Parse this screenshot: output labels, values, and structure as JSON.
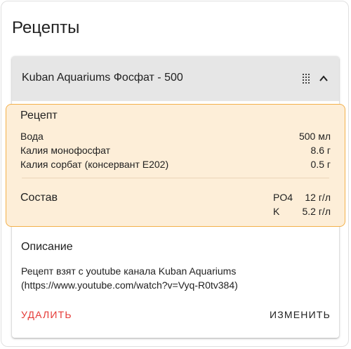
{
  "page": {
    "title": "Рецепты"
  },
  "card": {
    "title": "Kuban Aquariums Фосфат - 500",
    "icons": {
      "drag": "drag-handle-icon",
      "collapse": "chevron-up-icon"
    }
  },
  "recipe": {
    "title": "Рецепт",
    "items": [
      {
        "name": "Вода",
        "amount": "500 мл"
      },
      {
        "name": "Калия монофосфат",
        "amount": "8.6 г"
      },
      {
        "name": "Калия сорбат (консервант E202)",
        "amount": "0.5 г"
      }
    ]
  },
  "composition": {
    "title": "Состав",
    "items": [
      {
        "element": "PO4",
        "value": "12 г/л"
      },
      {
        "element": "K",
        "value": "5.2 г/л"
      }
    ]
  },
  "description": {
    "title": "Описание",
    "text": "Рецепт взят с youtube канала Kuban Aquariums (https://www.youtube.com/watch?v=Vyq-R0tv384)"
  },
  "actions": {
    "delete_label": "Удалить",
    "edit_label": "Изменить"
  },
  "colors": {
    "header_bg": "#e6e6e6",
    "highlight_bg": "#fdeed8",
    "highlight_border": "#f3b04a",
    "delete": "#e53935"
  }
}
